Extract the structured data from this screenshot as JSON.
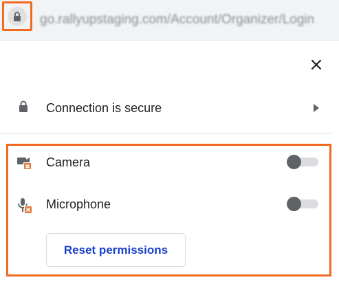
{
  "address_bar": {
    "url": "go.rallyupstaging.com/Account/Organizer/Login"
  },
  "popup": {
    "connection_label": "Connection is secure",
    "permissions": [
      {
        "name": "Camera",
        "icon": "camera-blocked-icon",
        "enabled": false
      },
      {
        "name": "Microphone",
        "icon": "microphone-blocked-icon",
        "enabled": false
      }
    ],
    "reset_label": "Reset permissions"
  },
  "colors": {
    "highlight": "#f26a1f",
    "blocked_badge": "#e37b3d",
    "link_blue": "#1a3fc8",
    "toggle_knob": "#5f6368"
  }
}
